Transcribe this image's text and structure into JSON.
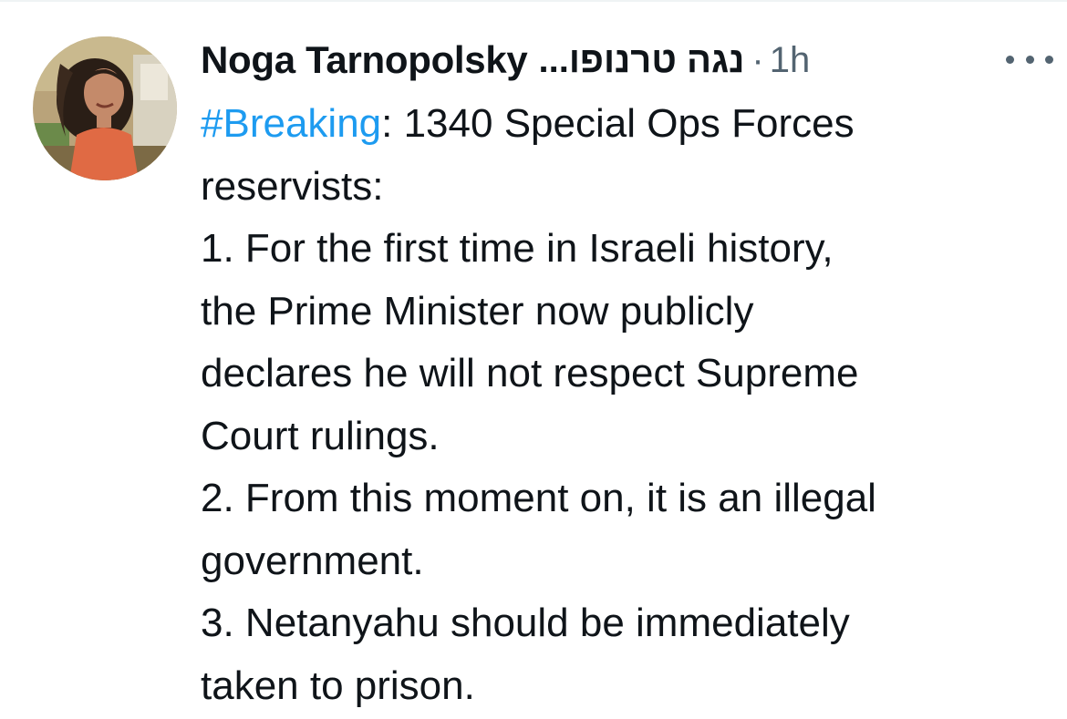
{
  "tweet": {
    "author": {
      "display_name": "Noga Tarnopolsky",
      "display_name_hebrew": "נגה טרנופו...",
      "avatar_icon": "profile-photo"
    },
    "separator": "·",
    "timestamp": "1h",
    "more_icon": "more-horizontal-icon",
    "hashtag": "#Breaking",
    "lines": [
      ": 1340 Special Ops Forces",
      "reservists:",
      "1. For the first time in Israeli history,",
      "the Prime Minister now publicly",
      "declares he will not respect Supreme",
      "Court rulings.",
      "2. From this moment on, it is an illegal",
      "government.",
      "3. Netanyahu should be immediately",
      "taken to prison."
    ]
  },
  "colors": {
    "text": "#0f1419",
    "secondary": "#536471",
    "link": "#1d9bf0",
    "background": "#ffffff"
  }
}
